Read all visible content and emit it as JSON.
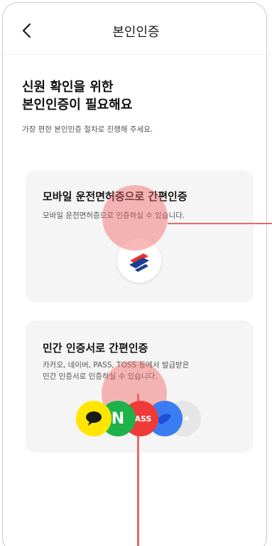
{
  "header": {
    "title": "본인인증",
    "back_icon": "chevron-left-icon"
  },
  "intro": {
    "headline_line1": "신원 확인을 위한",
    "headline_line2": "본인인증이 필요해요",
    "subline": "가장 편한 본인인증 절차로 진행해 주세요."
  },
  "options": [
    {
      "title": "모바일 운전면허증으로 간편인증",
      "desc_line1": "모바일 운전면허증으로 인증하실 수 있습니다.",
      "icon": "mobile-license-icon"
    },
    {
      "title": "민간 인증서로 간편인증",
      "desc_line1": "카카오, 네이버, PASS, TOSS 등에서 발급받은",
      "desc_line2": "민간 인증서로 인증하실 수 있습니다.",
      "providers": [
        {
          "name": "kakao",
          "icon": "kakao-icon",
          "color": "#ffe600"
        },
        {
          "name": "naver",
          "icon": "naver-icon",
          "label": "N",
          "color": "#1eb24a"
        },
        {
          "name": "pass",
          "icon": "pass-icon",
          "label": "PASS",
          "color": "#ef3a3a"
        },
        {
          "name": "toss",
          "icon": "toss-icon",
          "color": "#3a7df3"
        },
        {
          "name": "more",
          "icon": "more-icon",
          "color": "#e6e6e6"
        }
      ]
    }
  ],
  "colors": {
    "card_background": "#f5f5f5",
    "touch_indicator": "#f56464"
  }
}
